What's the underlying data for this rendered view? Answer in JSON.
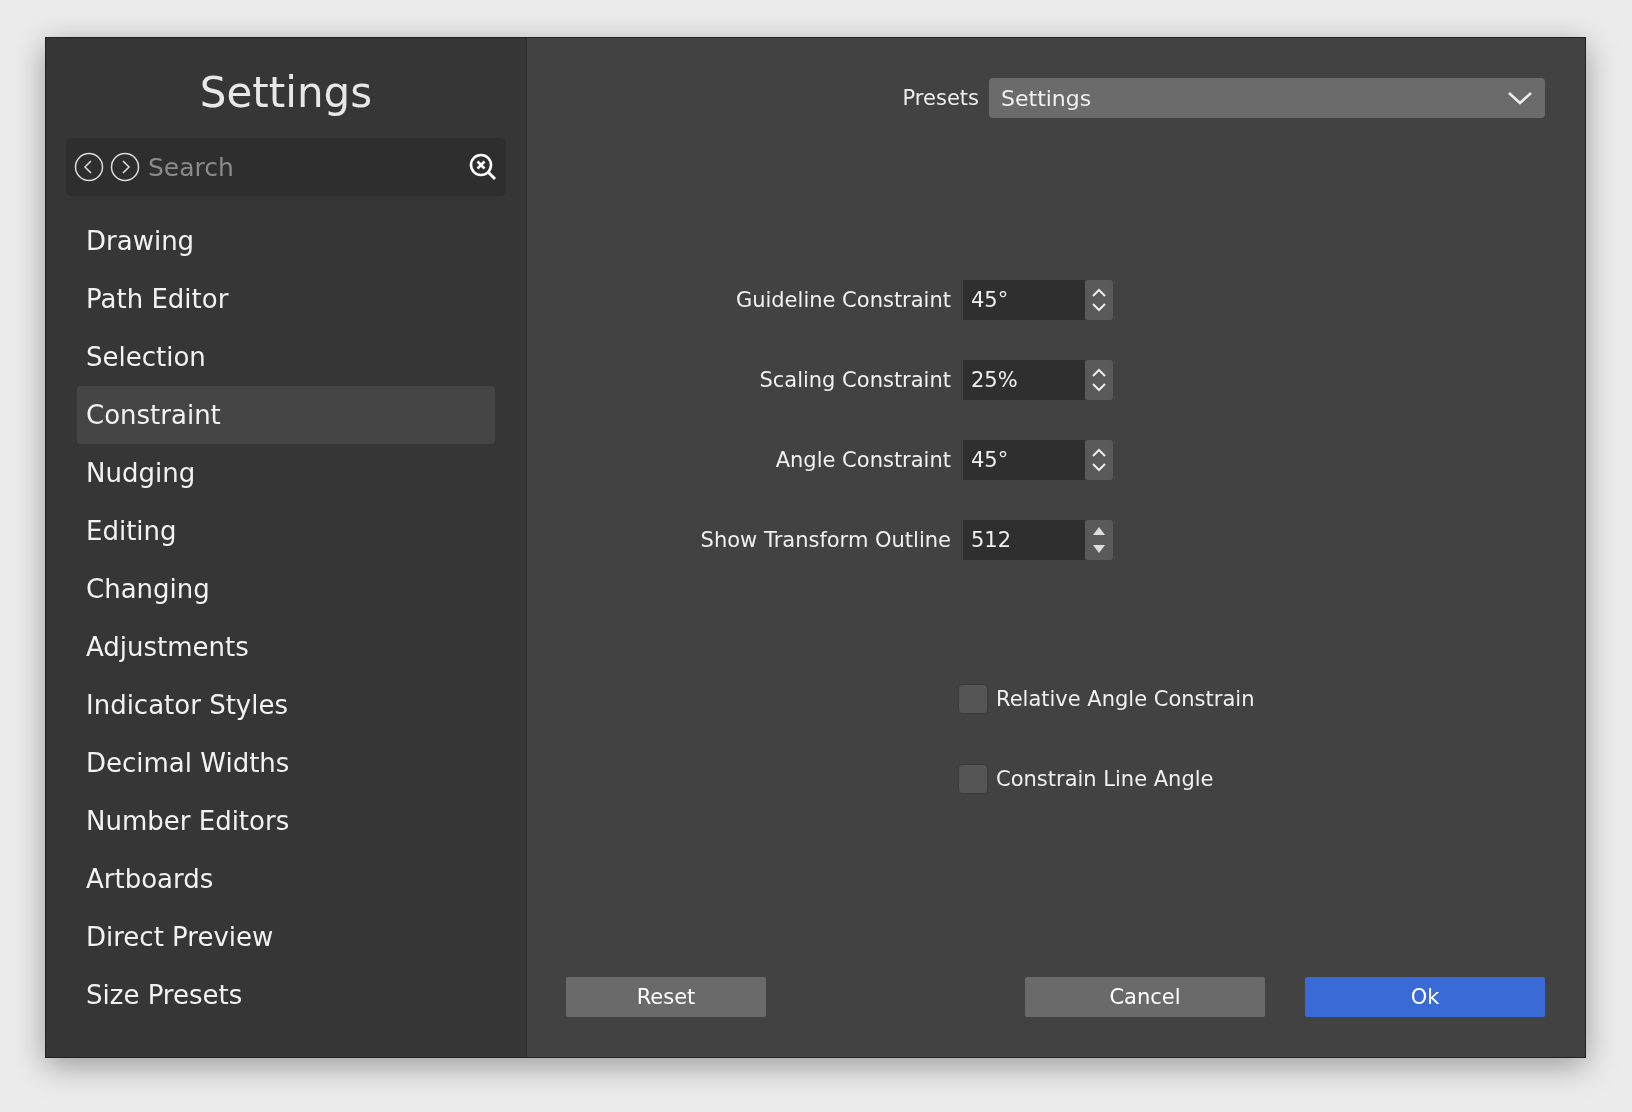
{
  "sidebar": {
    "title": "Settings",
    "search": {
      "placeholder": "Search"
    },
    "items": [
      {
        "label": "Drawing",
        "selected": false
      },
      {
        "label": "Path Editor",
        "selected": false
      },
      {
        "label": "Selection",
        "selected": false
      },
      {
        "label": "Constraint",
        "selected": true
      },
      {
        "label": "Nudging",
        "selected": false
      },
      {
        "label": "Editing",
        "selected": false
      },
      {
        "label": "Changing",
        "selected": false
      },
      {
        "label": "Adjustments",
        "selected": false
      },
      {
        "label": "Indicator Styles",
        "selected": false
      },
      {
        "label": "Decimal Widths",
        "selected": false
      },
      {
        "label": "Number Editors",
        "selected": false
      },
      {
        "label": "Artboards",
        "selected": false
      },
      {
        "label": "Direct Preview",
        "selected": false
      },
      {
        "label": "Size Presets",
        "selected": false
      }
    ]
  },
  "presets": {
    "label": "Presets",
    "value": "Settings"
  },
  "fields": [
    {
      "label": "Guideline Constraint",
      "value": "45°",
      "kind": "stepper"
    },
    {
      "label": "Scaling Constraint",
      "value": "25%",
      "kind": "stepper"
    },
    {
      "label": "Angle Constraint",
      "value": "45°",
      "kind": "stepper"
    },
    {
      "label": "Show Transform Outline",
      "value": "512",
      "kind": "arrows"
    }
  ],
  "checkboxes": [
    {
      "label": "Relative Angle Constrain",
      "checked": false
    },
    {
      "label": "Constrain Line Angle",
      "checked": false
    }
  ],
  "buttons": [
    {
      "label": "Reset",
      "kind": "plain"
    },
    {
      "label": "Cancel",
      "kind": "plain"
    },
    {
      "label": "Ok",
      "kind": "primary"
    }
  ]
}
